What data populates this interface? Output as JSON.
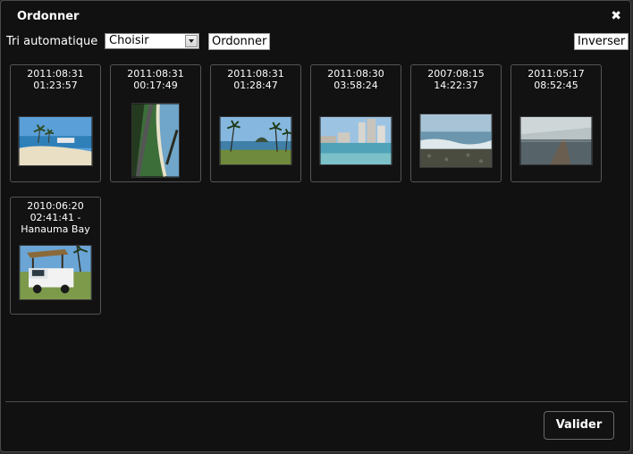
{
  "dialog": {
    "title": "Ordonner",
    "close_glyph": "✖"
  },
  "toolbar": {
    "sort_label": "Tri automatique",
    "sort_select_value": "Choisir",
    "order_button": "Ordonner",
    "reverse_button": "Inverser"
  },
  "photos": [
    {
      "label": "2011:08:31\n01:23:57",
      "scene": "beach-palms"
    },
    {
      "label": "2011:08:31\n00:17:49",
      "scene": "coastal-road"
    },
    {
      "label": "2011:08:31\n01:28:47",
      "scene": "palm-island"
    },
    {
      "label": "2011:08:30\n03:58:24",
      "scene": "city-beach"
    },
    {
      "label": "2007:08:15\n14:22:37",
      "scene": "rocky-shore"
    },
    {
      "label": "2011:05:17\n08:52:45",
      "scene": "pier-sunset"
    },
    {
      "label": "2010:06:20\n02:41:41 -\nHanauma Bay",
      "scene": "white-truck"
    }
  ],
  "footer": {
    "validate_button": "Valider"
  }
}
